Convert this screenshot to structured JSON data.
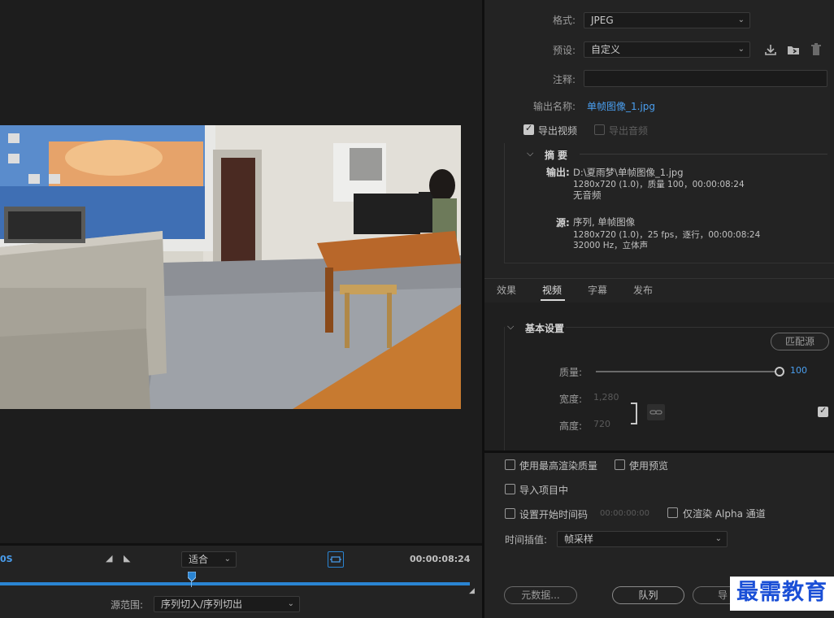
{
  "export": {
    "format_label": "格式:",
    "format_value": "JPEG",
    "preset_label": "预设:",
    "preset_value": "自定义",
    "comment_label": "注释:",
    "comment_value": "",
    "output_name_label": "输出名称:",
    "output_name_value": "单帧图像_1.jpg",
    "export_video_label": "导出视频",
    "export_video_checked": true,
    "export_audio_label": "导出音频",
    "export_audio_checked": false
  },
  "summary": {
    "title": "摘要",
    "output_label": "输出:",
    "output_path": "D:\\夏雨梦\\单帧图像_1.jpg",
    "output_details": "1280x720 (1.0)，质量 100，00:00:08:24",
    "output_audio": "无音频",
    "source_label": "源:",
    "source_name": "序列, 单帧图像",
    "source_details": "1280x720 (1.0)，25 fps，逐行，00:00:08:24",
    "source_audio": "32000 Hz，立体声"
  },
  "tabs": [
    "效果",
    "视频",
    "字幕",
    "发布"
  ],
  "video": {
    "section_title": "基本设置",
    "match_source_button": "匹配源",
    "quality_label": "质量:",
    "quality_value": "100",
    "quality_fraction": 1.0,
    "width_label": "宽度:",
    "width_value": "1,280",
    "height_label": "高度:",
    "height_value": "720"
  },
  "options": {
    "max_render_quality": "使用最高渲染质量",
    "use_previews": "使用预览",
    "import_into_project": "导入项目中",
    "set_start_timecode": "设置开始时间码",
    "start_timecode_value": "00:00:00:00",
    "render_alpha_only": "仅渲染 Alpha 通道",
    "time_interpolation_label": "时间插值:",
    "time_interpolation_value": "帧采样"
  },
  "buttons": {
    "metadata": "元数据...",
    "queue": "队列",
    "export": "导"
  },
  "timeline": {
    "left_timecode": "0S",
    "fit_value": "适合",
    "end_timecode": "00:00:08:24",
    "source_range_label": "源范围:",
    "source_range_value": "序列切入/序列切出"
  },
  "watermark": "最需教育",
  "colors": {
    "accent": "#2a84d2",
    "link": "#4a9ff0",
    "watermark": "#1a4fd6"
  }
}
